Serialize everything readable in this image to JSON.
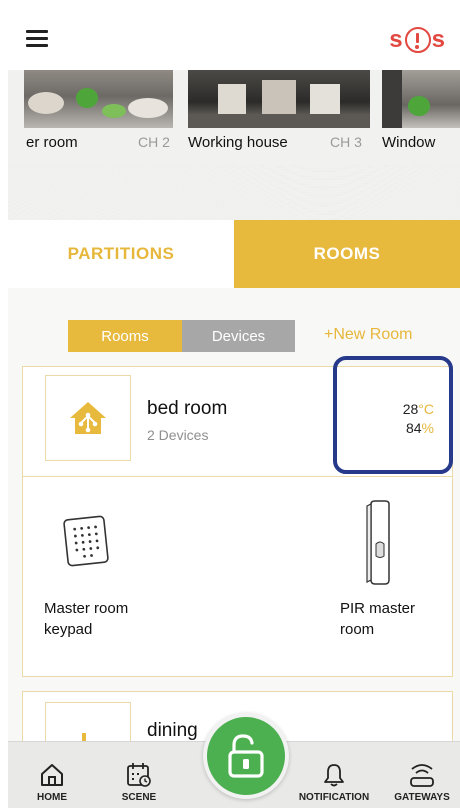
{
  "header": {
    "menu_icon": "hamburger-menu-icon",
    "sos_label": "SOS"
  },
  "cameras": [
    {
      "name": "er room",
      "channel": ""
    },
    {
      "name": "Working house",
      "channel": "CH 2"
    },
    {
      "name": "Window",
      "channel": "CH 3"
    }
  ],
  "tabs": {
    "partitions": "PARTITIONS",
    "rooms": "ROOMS",
    "active": "rooms"
  },
  "segment": {
    "rooms": "Rooms",
    "devices": "Devices",
    "active": "rooms"
  },
  "new_room_label": "+New Room",
  "room": {
    "name": "bed room",
    "device_count": "2 Devices",
    "temperature": "28",
    "temperature_unit": "°C",
    "humidity": "84",
    "humidity_unit": "%",
    "icon": "smart-home-icon",
    "devices": [
      {
        "name": "Master room keypad",
        "icon": "keypad-icon"
      },
      {
        "name": "PIR master room",
        "icon": "pir-sensor-icon"
      }
    ]
  },
  "next_room": {
    "name": "dining",
    "sub": "c"
  },
  "bottom_nav": {
    "home": "HOME",
    "scene": "SCENE",
    "notification": "NOTIFICATION",
    "gateways": "GATEWAYS",
    "center_icon": "unlock-icon"
  },
  "colors": {
    "accent": "#e7b93d",
    "sos": "#e2483f",
    "fab": "#4caf50",
    "highlight": "#26398a"
  }
}
